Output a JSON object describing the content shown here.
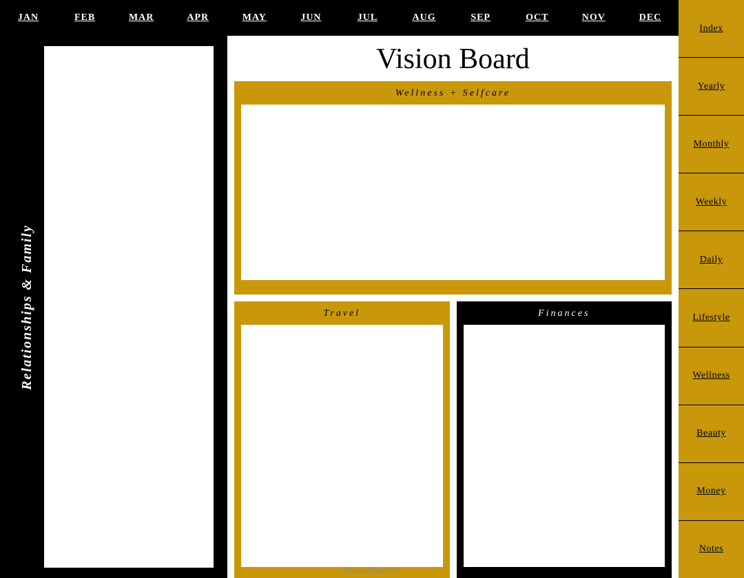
{
  "nav": {
    "months": [
      "JAN",
      "FEB",
      "MAR",
      "APR",
      "MAY",
      "JUN",
      "JUL",
      "AUG",
      "SEP",
      "OCT",
      "NOV",
      "DEC"
    ]
  },
  "main": {
    "title": "Vision Board",
    "left_label": "Relationships & Family",
    "wellness": {
      "label": "Wellness + Selfcare"
    },
    "travel": {
      "label": "Travel"
    },
    "finances": {
      "label": "Finances"
    }
  },
  "sidebar": {
    "items": [
      {
        "label": "Index"
      },
      {
        "label": "Yearly"
      },
      {
        "label": "Monthly"
      },
      {
        "label": "Weekly"
      },
      {
        "label": "Daily"
      },
      {
        "label": "Lifestyle"
      },
      {
        "label": "Wellness"
      },
      {
        "label": "Beauty"
      },
      {
        "label": "Money"
      },
      {
        "label": "Notes"
      }
    ]
  },
  "footer": {
    "credit": "@digitallyposhlife"
  }
}
